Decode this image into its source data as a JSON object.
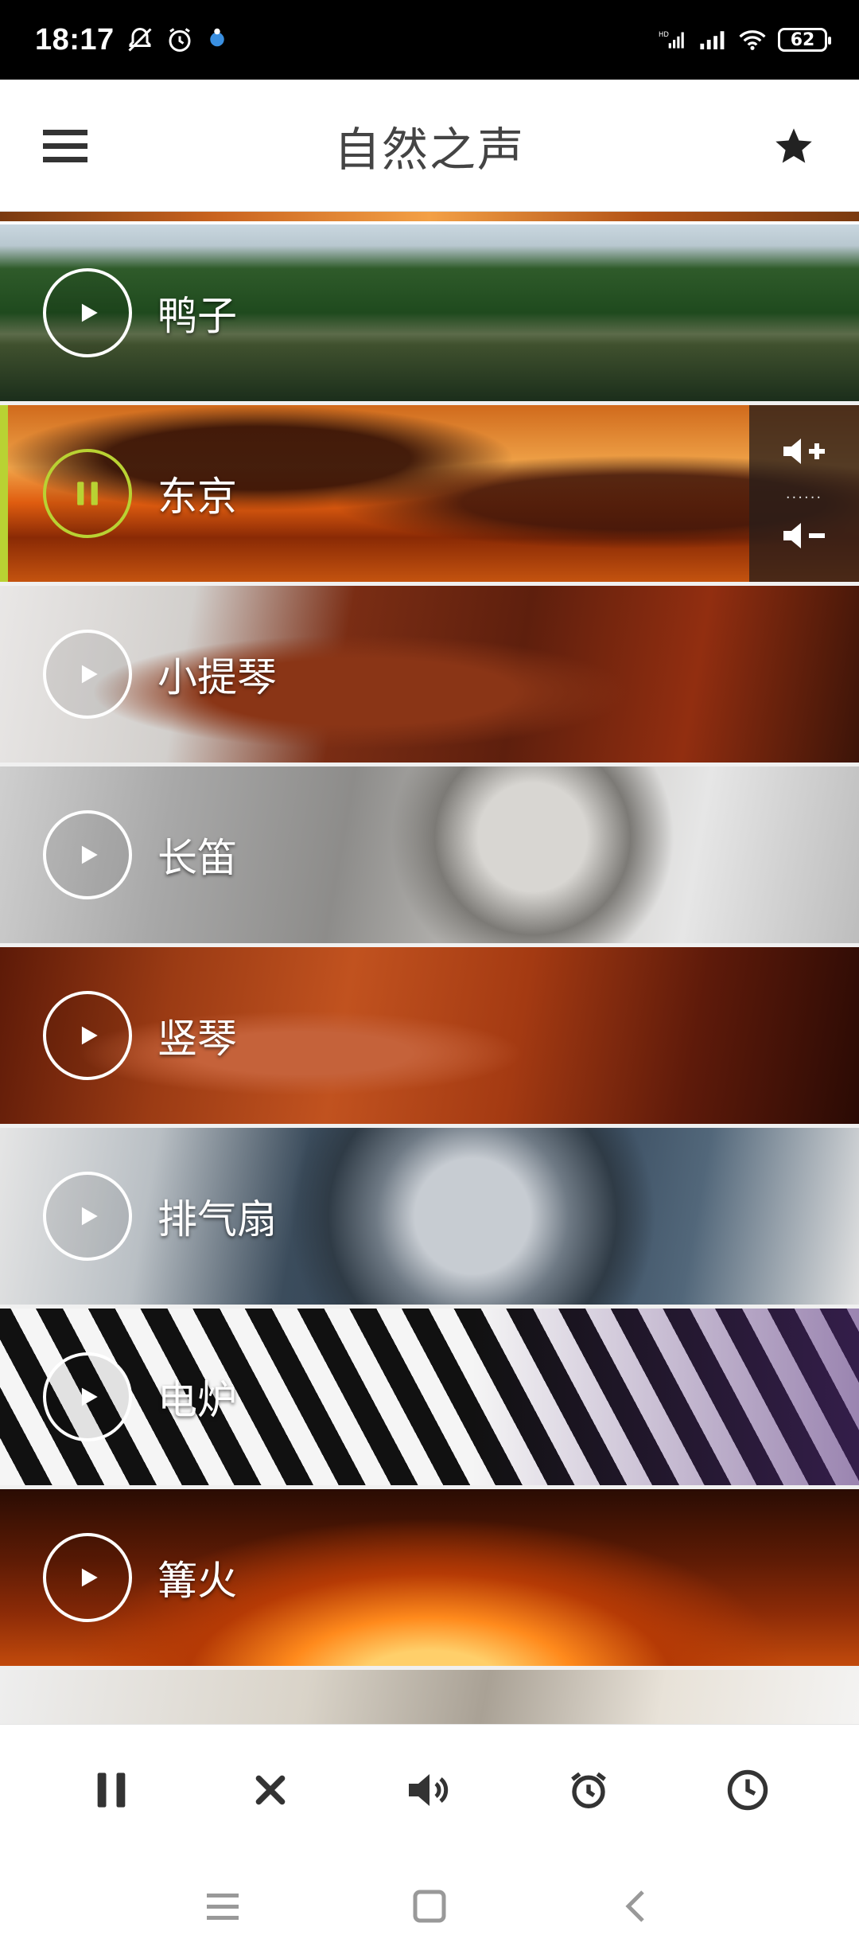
{
  "status_bar": {
    "time": "18:17",
    "battery": "62",
    "icons": [
      "mute-bell-icon",
      "alarm-icon",
      "app-notification-icon",
      "hd-signal-icon",
      "signal-icon",
      "wifi-icon",
      "battery-icon"
    ]
  },
  "header": {
    "title": "自然之声",
    "menu_icon": "hamburger-icon",
    "favorite_icon": "star-icon"
  },
  "sounds": [
    {
      "label": "鸭子",
      "state": "stopped"
    },
    {
      "label": "东京",
      "state": "playing"
    },
    {
      "label": "小提琴",
      "state": "stopped"
    },
    {
      "label": "长笛",
      "state": "stopped"
    },
    {
      "label": "竖琴",
      "state": "stopped"
    },
    {
      "label": "排气扇",
      "state": "stopped"
    },
    {
      "label": "电炉",
      "state": "stopped"
    },
    {
      "label": "篝火",
      "state": "stopped"
    }
  ],
  "active_volume_dots": "......",
  "colors": {
    "accent": "#b9d233",
    "title_text": "#444444"
  },
  "controls": [
    "pause-icon",
    "close-icon",
    "volume-icon",
    "alarm-clock-icon",
    "timer-clock-icon"
  ],
  "nav": [
    "recent-apps-icon",
    "home-icon",
    "back-icon"
  ]
}
